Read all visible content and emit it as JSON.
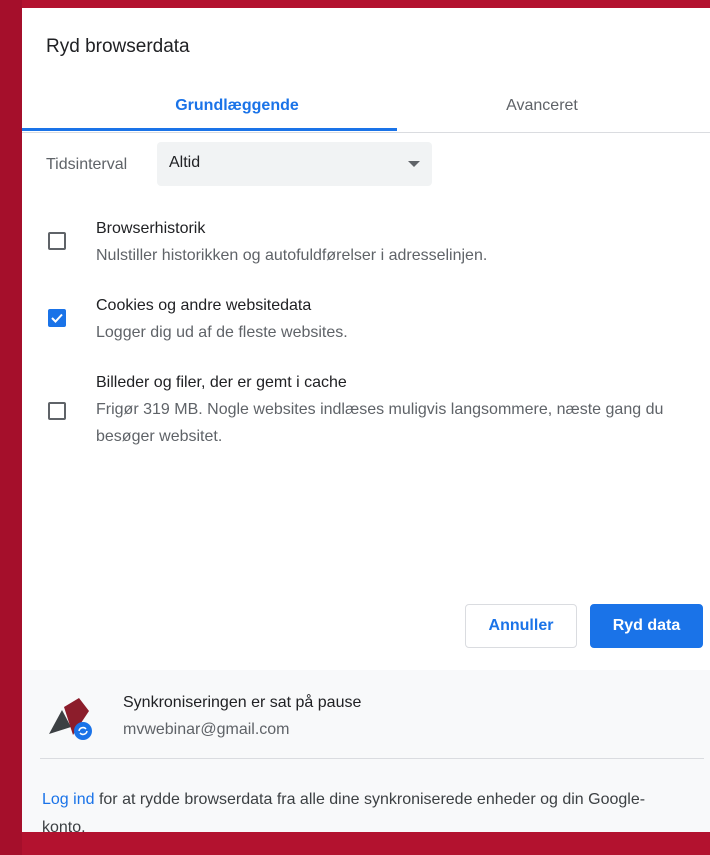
{
  "dialog": {
    "title": "Ryd browserdata",
    "tabs": [
      {
        "label": "Grundlæggende",
        "active": true
      },
      {
        "label": "Avanceret",
        "active": false
      }
    ]
  },
  "time_range": {
    "label": "Tidsinterval",
    "value": "Altid"
  },
  "options": [
    {
      "title": "Browserhistorik",
      "description": "Nulstiller historikken og autofuldførelser i adresselinjen.",
      "checked": false
    },
    {
      "title": "Cookies og andre websitedata",
      "description": "Logger dig ud af de fleste websites.",
      "checked": true
    },
    {
      "title": "Billeder og filer, der er gemt i cache",
      "description": "Frigør 319 MB. Nogle websites indlæses muligvis langsommere, næste gang du besøger websitet.",
      "checked": false
    }
  ],
  "buttons": {
    "cancel": "Annuller",
    "clear": "Ryd data"
  },
  "sync": {
    "status": "Synkroniseringen er sat på pause",
    "email": "mvwebinar@gmail.com"
  },
  "footer": {
    "link": "Log ind",
    "text": " for at rydde browserdata fra alle dine synkroniserede enheder og din Google-konto."
  },
  "colors": {
    "accent": "#1a73e8",
    "background": "#b3122f"
  }
}
